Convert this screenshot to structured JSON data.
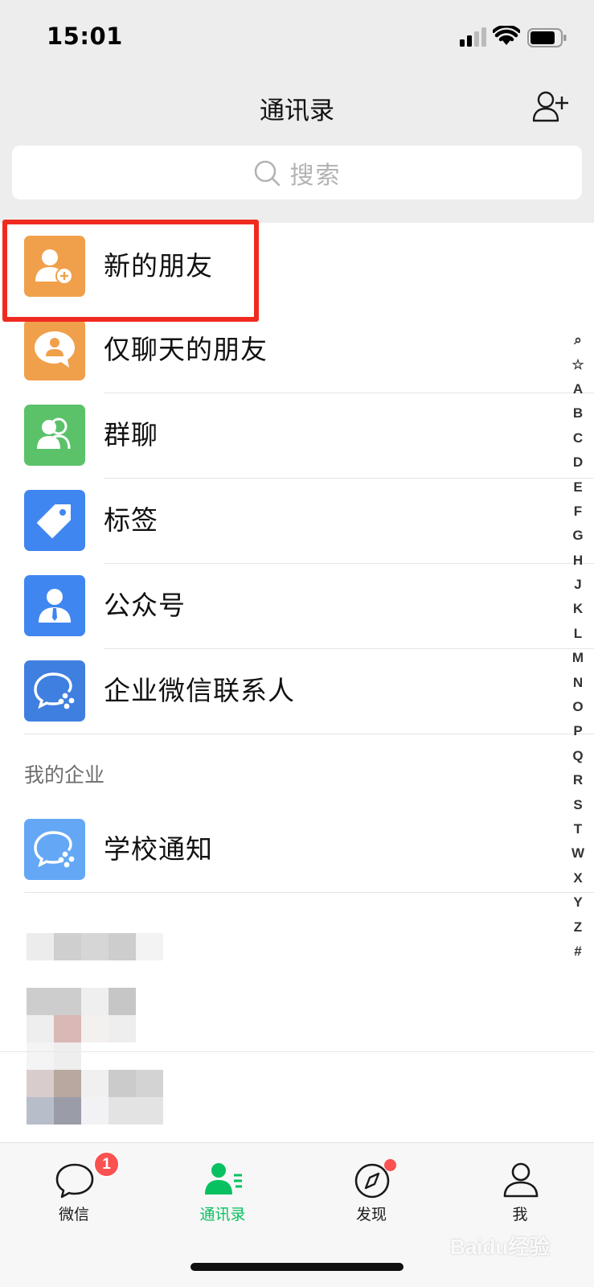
{
  "status_bar": {
    "time": "15:01"
  },
  "nav": {
    "title": "通讯录"
  },
  "search": {
    "placeholder": "搜索"
  },
  "contacts_menu": [
    {
      "label": "新的朋友",
      "icon": "new-friend-icon",
      "color": "#f0a04b"
    },
    {
      "label": "仅聊天的朋友",
      "icon": "chat-only-friend-icon",
      "color": "#f0a04b"
    },
    {
      "label": "群聊",
      "icon": "group-chat-icon",
      "color": "#5bc26a"
    },
    {
      "label": "标签",
      "icon": "tag-icon",
      "color": "#3f86f1"
    },
    {
      "label": "公众号",
      "icon": "official-account-icon",
      "color": "#3f86f1"
    },
    {
      "label": "企业微信联系人",
      "icon": "wecom-contacts-icon",
      "color": "#3f7fe0"
    }
  ],
  "enterprise_section": {
    "header": "我的企业",
    "items": [
      {
        "label": "学校通知",
        "icon": "wecom-school-icon",
        "color": "#64a8f5"
      }
    ]
  },
  "index_bar": [
    "⌕",
    "☆",
    "A",
    "B",
    "C",
    "D",
    "E",
    "F",
    "G",
    "H",
    "J",
    "K",
    "L",
    "M",
    "N",
    "O",
    "P",
    "Q",
    "R",
    "S",
    "T",
    "W",
    "X",
    "Y",
    "Z",
    "#"
  ],
  "tab_bar": {
    "items": [
      {
        "label": "微信",
        "icon": "chat-bubble-icon",
        "badge": "1"
      },
      {
        "label": "通讯录",
        "icon": "contacts-icon",
        "active": true
      },
      {
        "label": "发现",
        "icon": "compass-icon",
        "dot": true
      },
      {
        "label": "我",
        "icon": "person-icon"
      }
    ]
  },
  "watermark": "Baidu经验",
  "colors": {
    "accent": "#07c160",
    "highlight": "#f02a21",
    "badge": "#fa5151"
  }
}
